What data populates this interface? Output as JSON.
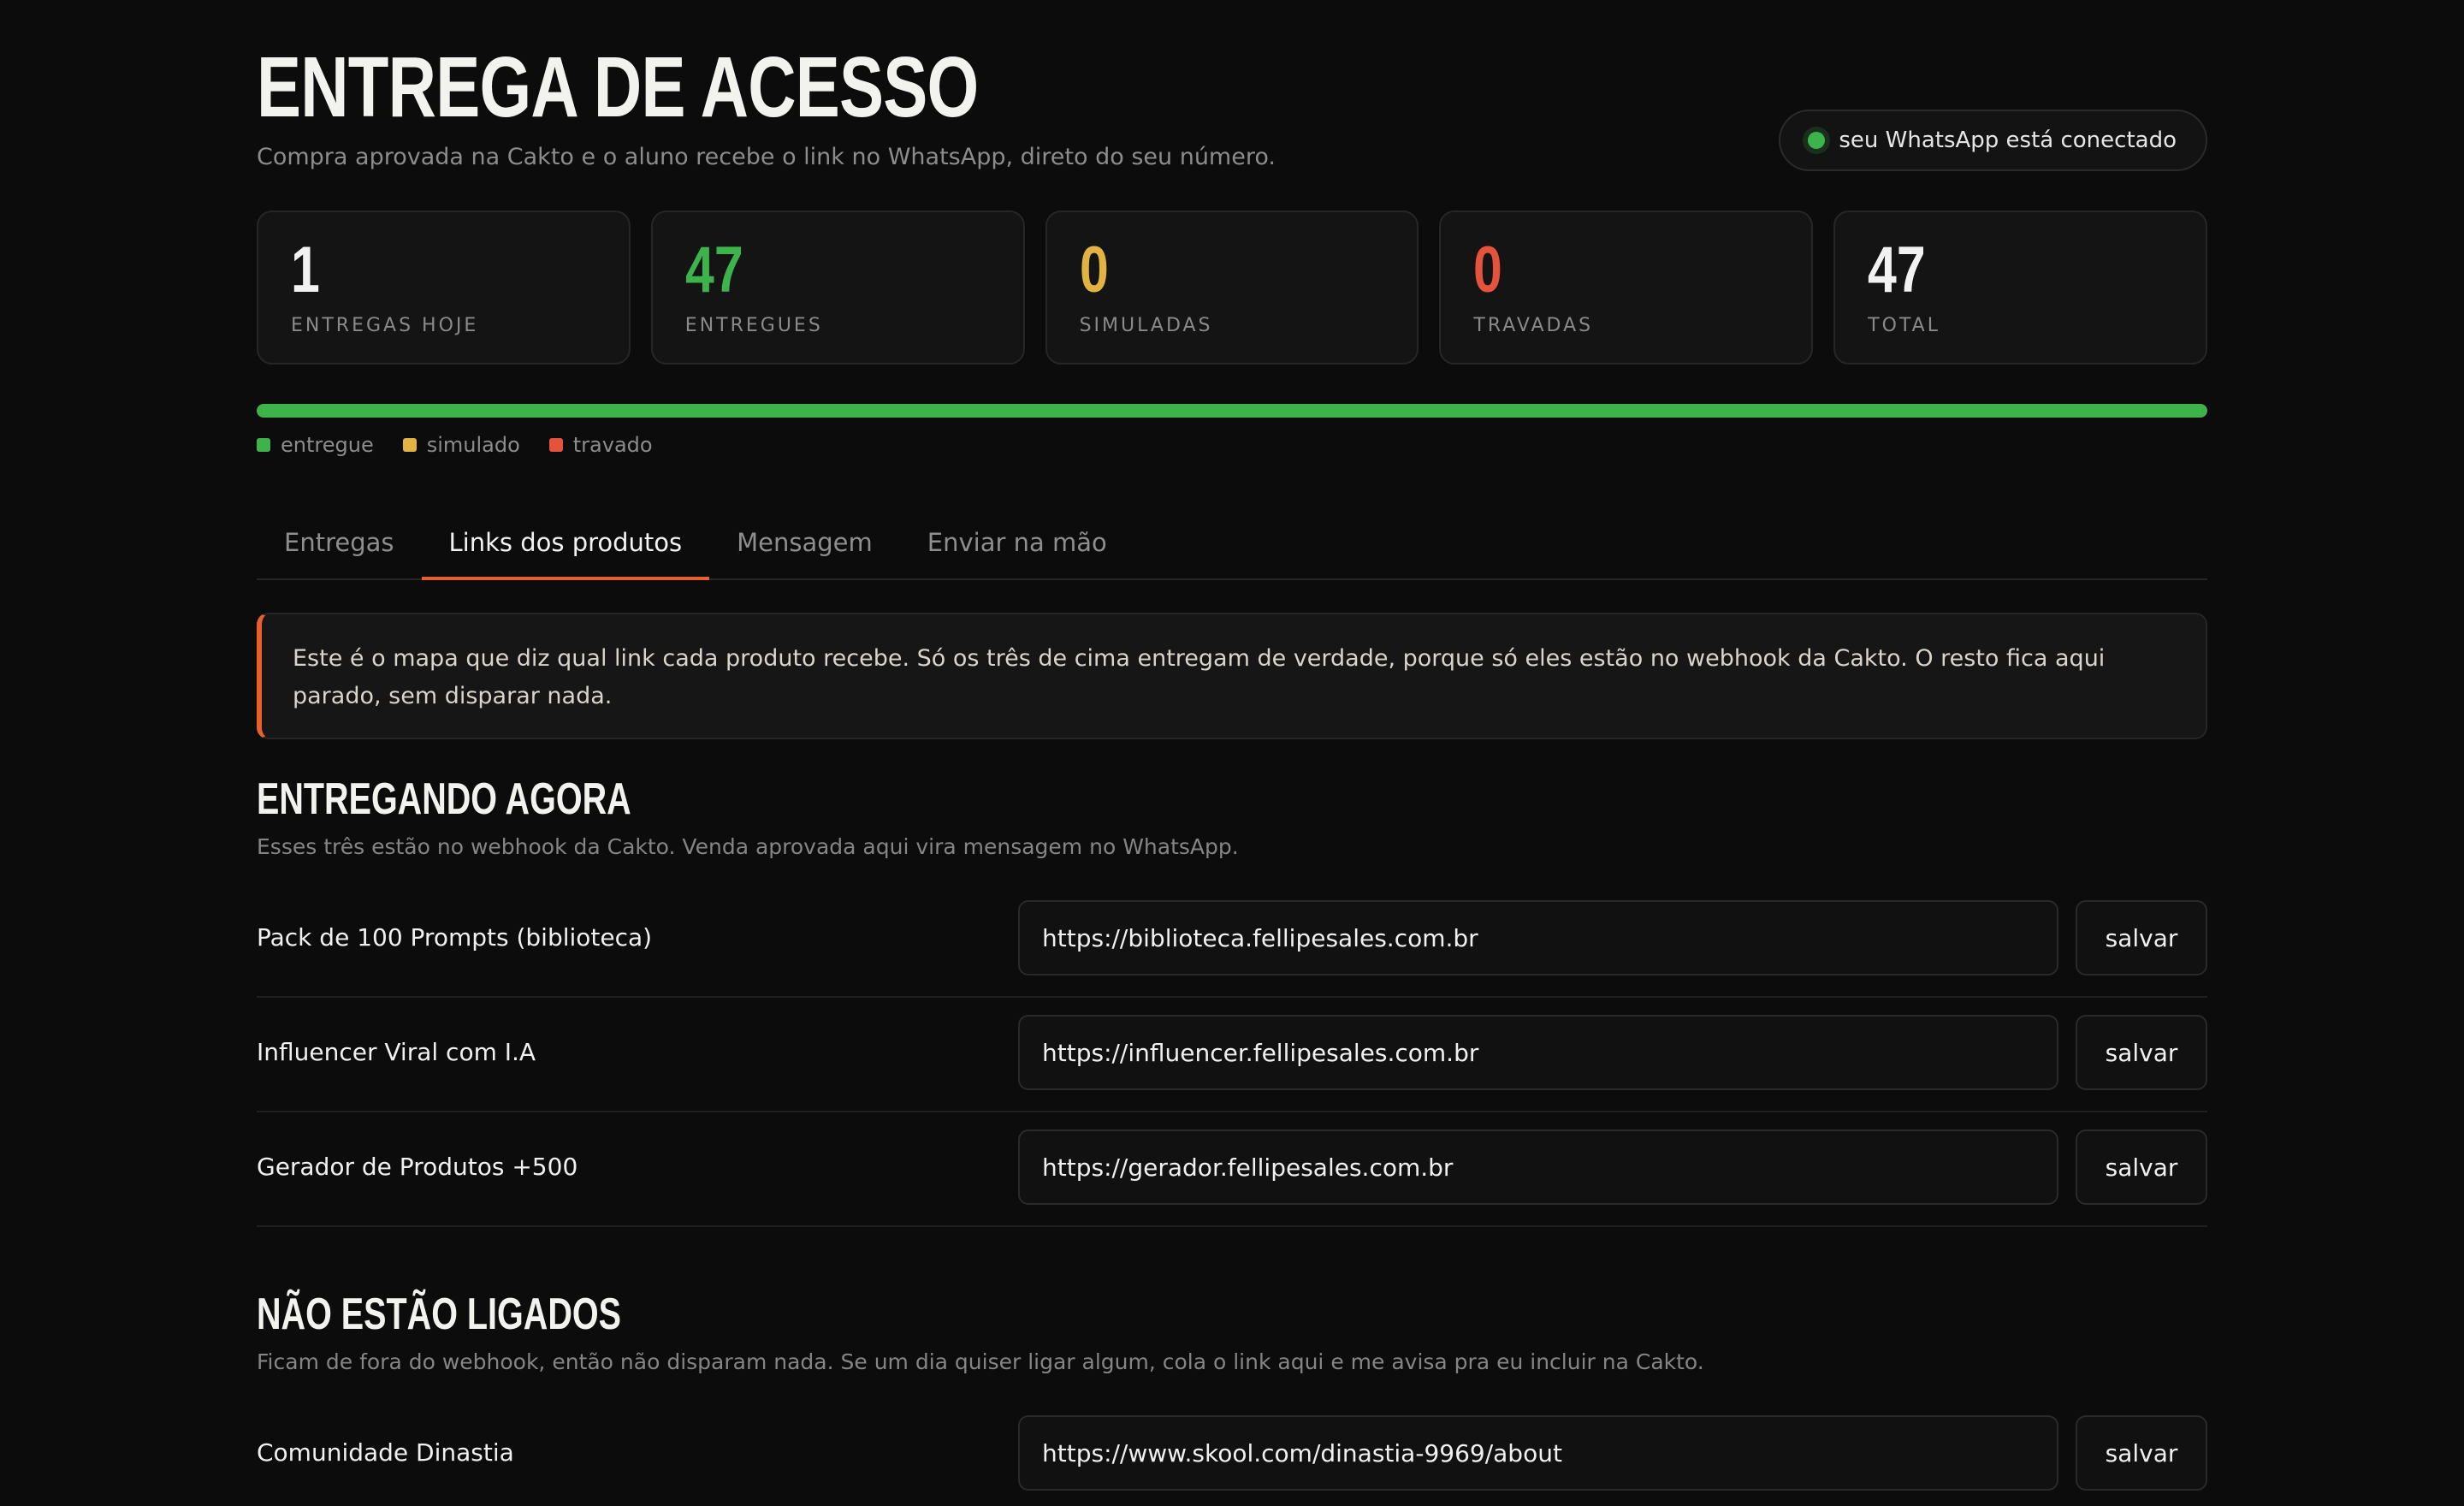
{
  "header": {
    "title": "ENTREGA DE ACESSO",
    "subtitle": "Compra aprovada na Cakto e o aluno recebe o link no WhatsApp, direto do seu número.",
    "whatsapp_status": "seu WhatsApp está conectado"
  },
  "colors": {
    "accent": "#e8602c",
    "green": "#3cb44b",
    "yellow": "#e3b341",
    "red": "#e5533d",
    "white": "#f2f2f2"
  },
  "stats": [
    {
      "value": "1",
      "label": "ENTREGAS HOJE",
      "color": "#f2f2f2"
    },
    {
      "value": "47",
      "label": "ENTREGUES",
      "color": "#3cb44b"
    },
    {
      "value": "0",
      "label": "SIMULADAS",
      "color": "#e3b341"
    },
    {
      "value": "0",
      "label": "TRAVADAS",
      "color": "#e5533d"
    },
    {
      "value": "47",
      "label": "TOTAL",
      "color": "#f2f2f2"
    }
  ],
  "progress": {
    "entregue": 47,
    "simulado": 0,
    "travado": 0,
    "total": 47
  },
  "legend": [
    {
      "label": "entregue",
      "color": "#3cb44b"
    },
    {
      "label": "simulado",
      "color": "#e3b341"
    },
    {
      "label": "travado",
      "color": "#e5533d"
    }
  ],
  "tabs": [
    {
      "label": "Entregas",
      "active": false
    },
    {
      "label": "Links dos produtos",
      "active": true
    },
    {
      "label": "Mensagem",
      "active": false
    },
    {
      "label": "Enviar na mão",
      "active": false
    }
  ],
  "notice": "Este é o mapa que diz qual link cada produto recebe. Só os três de cima entregam de verdade, porque só eles estão no webhook da Cakto. O resto fica aqui parado, sem disparar nada.",
  "section_active": {
    "title": "ENTREGANDO AGORA",
    "description": "Esses três estão no webhook da Cakto. Venda aprovada aqui vira mensagem no WhatsApp.",
    "products": [
      {
        "name": "Pack de 100 Prompts (biblioteca)",
        "link": "https://biblioteca.fellipesales.com.br",
        "save_label": "salvar"
      },
      {
        "name": "Influencer Viral com I.A",
        "link": "https://influencer.fellipesales.com.br",
        "save_label": "salvar"
      },
      {
        "name": "Gerador de Produtos +500",
        "link": "https://gerador.fellipesales.com.br",
        "save_label": "salvar"
      }
    ]
  },
  "section_inactive": {
    "title": "NÃO ESTÃO LIGADOS",
    "description": "Ficam de fora do webhook, então não disparam nada. Se um dia quiser ligar algum, cola o link aqui e me avisa pra eu incluir na Cakto.",
    "products": [
      {
        "name": "Comunidade Dinastia",
        "link": "https://www.skool.com/dinastia-9969/about",
        "save_label": "salvar"
      }
    ]
  }
}
